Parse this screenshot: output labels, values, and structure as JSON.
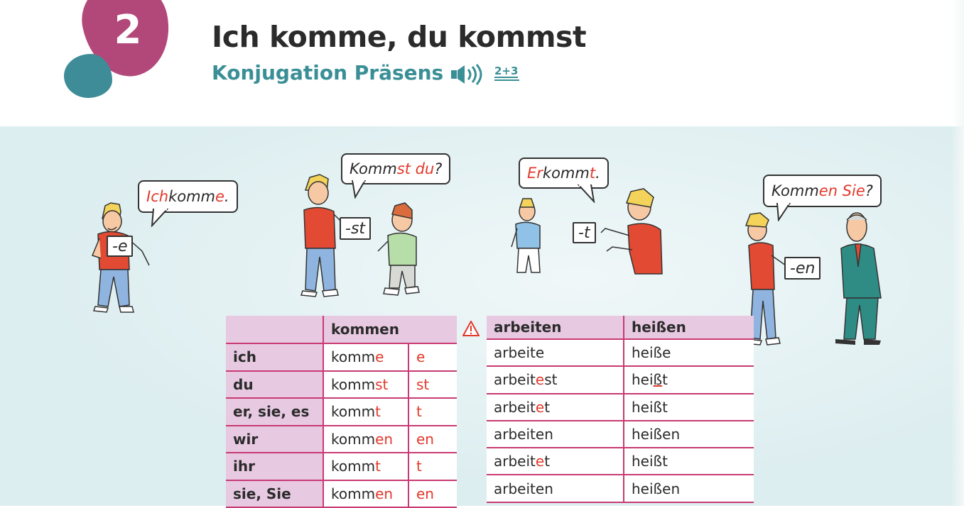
{
  "header": {
    "lesson_number": "2",
    "title": "Ich komme, du kommst",
    "subtitle": "Konjugation Präsens",
    "track": "2+3"
  },
  "icons": [
    "speaker-icon",
    "warning-icon"
  ],
  "bubbles": [
    {
      "parts": [
        {
          "t": "Ich",
          "red": true
        },
        {
          "t": " komm",
          "red": false
        },
        {
          "t": "e",
          "red": true
        },
        {
          "t": ".",
          "red": false
        }
      ]
    },
    {
      "parts": [
        {
          "t": "Komm",
          "red": false
        },
        {
          "t": "st du",
          "red": true
        },
        {
          "t": "?",
          "red": false
        }
      ]
    },
    {
      "parts": [
        {
          "t": "Er",
          "red": true
        },
        {
          "t": " komm",
          "red": false
        },
        {
          "t": "t",
          "red": true
        },
        {
          "t": ".",
          "red": false
        }
      ]
    },
    {
      "parts": [
        {
          "t": "Komm",
          "red": false
        },
        {
          "t": "en Sie",
          "red": true
        },
        {
          "t": "?",
          "red": false
        }
      ]
    }
  ],
  "cards": [
    "-e",
    "-st",
    "-t",
    "-en"
  ],
  "table_kommen": {
    "header": "kommen",
    "rows": [
      {
        "pronoun": "ich",
        "stem": "komm",
        "ending": "e",
        "end_col": "e"
      },
      {
        "pronoun": "du",
        "stem": "komm",
        "ending": "st",
        "end_col": "st"
      },
      {
        "pronoun": "er, sie, es",
        "stem": "komm",
        "ending": "t",
        "end_col": "t"
      },
      {
        "pronoun": "wir",
        "stem": "komm",
        "ending": "en",
        "end_col": "en"
      },
      {
        "pronoun": "ihr",
        "stem": "komm",
        "ending": "t",
        "end_col": "t"
      },
      {
        "pronoun": "sie, Sie",
        "stem": "komm",
        "ending": "en",
        "end_col": "en"
      }
    ]
  },
  "table_other": {
    "headers": [
      "arbeiten",
      "heißen"
    ],
    "rows": [
      {
        "a_stem": "arbeit",
        "a_mid": "",
        "a_end": "e",
        "h": "heiße",
        "h_pre": "",
        "h_u": ""
      },
      {
        "a_stem": "arbeit",
        "a_mid": "e",
        "a_end": "st",
        "h": "",
        "h_pre": "hei",
        "h_u": "ß",
        "h_post": "t"
      },
      {
        "a_stem": "arbeit",
        "a_mid": "e",
        "a_end": "t",
        "h": "heißt",
        "h_pre": "",
        "h_u": ""
      },
      {
        "a_stem": "arbeit",
        "a_mid": "",
        "a_end": "en",
        "h": "heißen",
        "h_pre": "",
        "h_u": ""
      },
      {
        "a_stem": "arbeit",
        "a_mid": "e",
        "a_end": "t",
        "h": "heißt",
        "h_pre": "",
        "h_u": ""
      },
      {
        "a_stem": "arbeit",
        "a_mid": "",
        "a_end": "en",
        "h": "heißen",
        "h_pre": "",
        "h_u": ""
      }
    ]
  },
  "colors": {
    "pink": "#b2477a",
    "teal": "#3e8c98",
    "accent_red": "#e2392b",
    "table_header": "#e7c9e1",
    "panel": "#ddeef0"
  }
}
